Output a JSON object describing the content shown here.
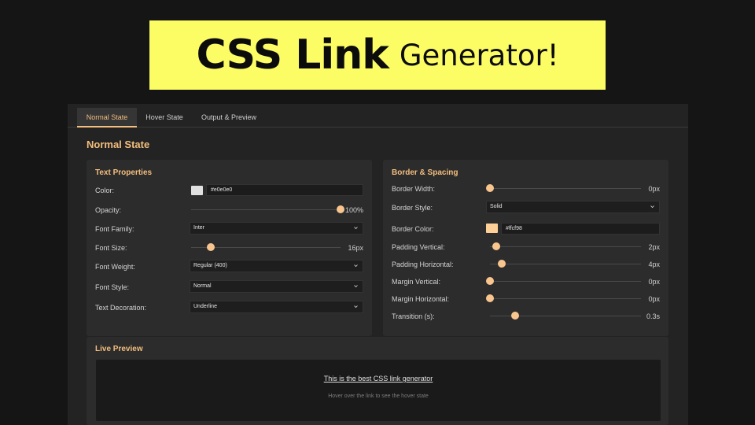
{
  "banner": {
    "title_bold": "CSS Link",
    "title_light": "Generator!"
  },
  "tabs": [
    {
      "label": "Normal State",
      "active": true
    },
    {
      "label": "Hover State",
      "active": false
    },
    {
      "label": "Output & Preview",
      "active": false
    }
  ],
  "section_title": "Normal State",
  "text_properties": {
    "title": "Text Properties",
    "color": {
      "label": "Color:",
      "value": "#e0e0e0",
      "swatch": "#e0e0e0"
    },
    "opacity": {
      "label": "Opacity:",
      "value": "100%",
      "level": 1.0
    },
    "font_family": {
      "label": "Font Family:",
      "selected": "Inter"
    },
    "font_size": {
      "label": "Font Size:",
      "value": "16px",
      "level": 0.13
    },
    "font_weight": {
      "label": "Font Weight:",
      "selected": "Regular (400)"
    },
    "font_style": {
      "label": "Font Style:",
      "selected": "Normal"
    },
    "text_decoration": {
      "label": "Text Decoration:",
      "selected": "Underline"
    }
  },
  "border_spacing": {
    "title": "Border & Spacing",
    "border_width": {
      "label": "Border Width:",
      "value": "0px",
      "level": 0.0
    },
    "border_style": {
      "label": "Border Style:",
      "selected": "Solid"
    },
    "border_color": {
      "label": "Border Color:",
      "value": "#ffcf98",
      "swatch": "#ffcf98"
    },
    "padding_vertical": {
      "label": "Padding Vertical:",
      "value": "2px",
      "level": 0.04
    },
    "padding_horizontal": {
      "label": "Padding Horizontal:",
      "value": "4px",
      "level": 0.08
    },
    "margin_vertical": {
      "label": "Margin Vertical:",
      "value": "0px",
      "level": 0.0
    },
    "margin_horizontal": {
      "label": "Margin Horizontal:",
      "value": "0px",
      "level": 0.0
    },
    "transition": {
      "label": "Transition (s):",
      "value": "0.3s",
      "level": 0.165
    }
  },
  "live_preview": {
    "title": "Live Preview",
    "link_text": "This is the best CSS link generator",
    "hint": "Hover over the link to see the hover state"
  },
  "colors": {
    "accent": "#f4be7e",
    "slider_thumb": "#f9c58e",
    "banner": "#fcfc64"
  },
  "icons": {
    "select_arrow": "chevron-down-icon"
  }
}
